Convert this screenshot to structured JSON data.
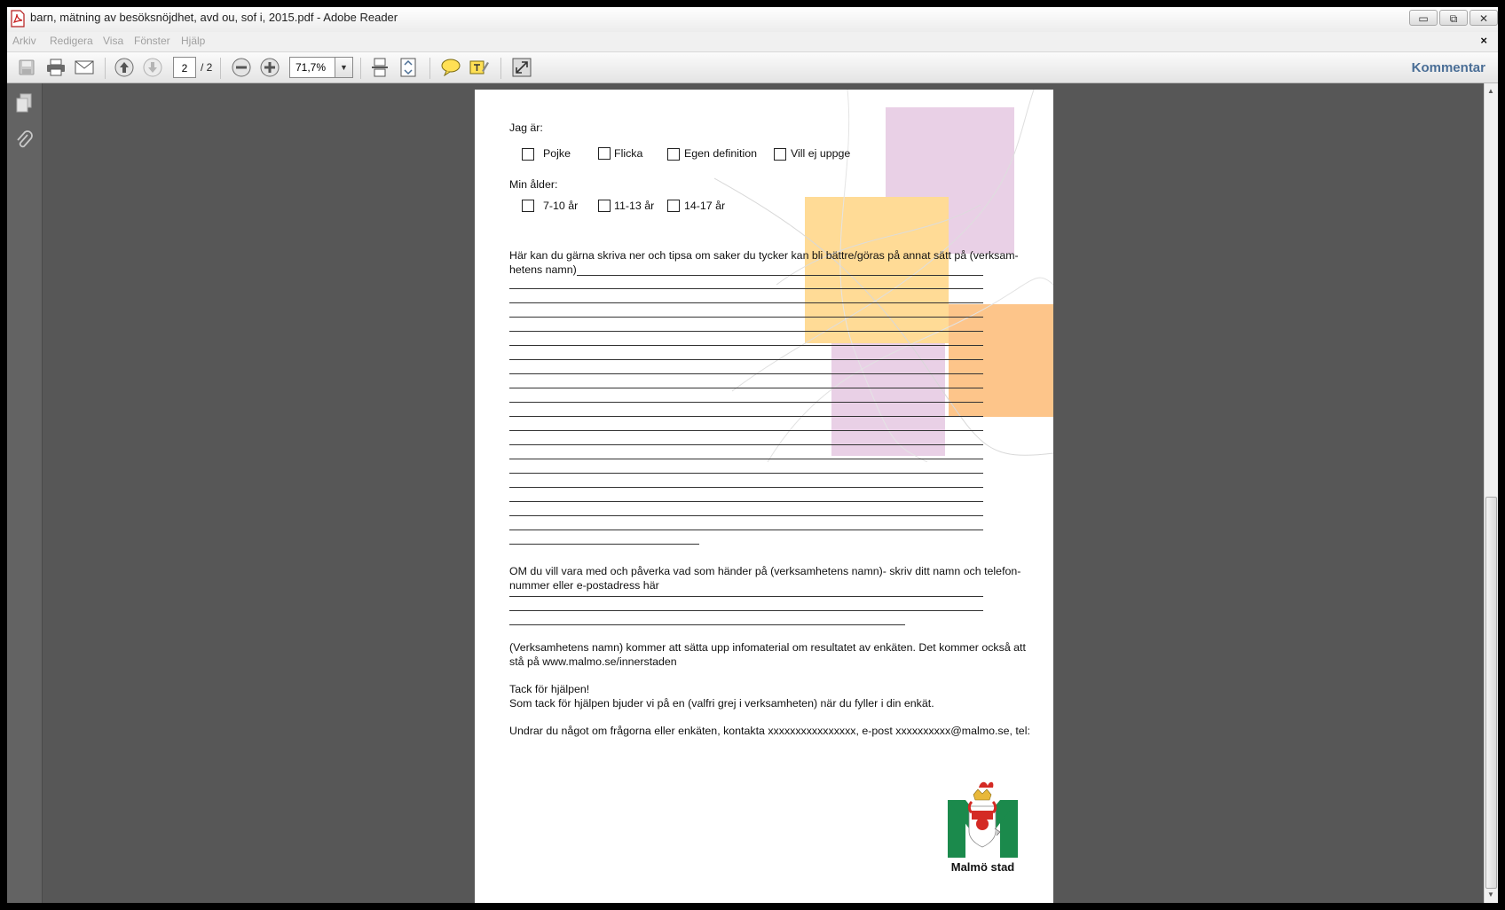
{
  "window": {
    "title": "barn, mätning av besöksnöjdhet, avd ou, sof i, 2015.pdf - Adobe Reader",
    "controls": {
      "minimize": "▭",
      "maximize": "⧉",
      "close": "✕"
    }
  },
  "menu": {
    "items": [
      "Arkiv",
      "Redigera",
      "Visa",
      "Fönster",
      "Hjälp"
    ],
    "close_doc": "×"
  },
  "toolbar": {
    "page_current": "2",
    "page_total": "/ 2",
    "zoom": "71,7%",
    "comment_label": "Kommentar",
    "icons": [
      "save-icon",
      "print-icon",
      "email-icon",
      "prev-page-icon",
      "next-page-icon",
      "zoom-out-icon",
      "zoom-in-icon",
      "scroll-mode-icon",
      "fit-page-icon",
      "sticky-note-icon",
      "highlight-icon",
      "fullscreen-icon"
    ]
  },
  "document": {
    "gender_label": "Jag är:",
    "gender_options": [
      "Pojke",
      "Flicka",
      "Egen definition",
      "Vill ej uppge"
    ],
    "age_label": "Min ålder:",
    "age_options": [
      "7-10 år",
      "11-13 år",
      "14-17 år"
    ],
    "tips_line1": "Här kan du gärna skriva ner och tipsa om saker du tycker kan bli bättre/göras på annat sätt på (verksam-",
    "tips_line2": "hetens namn)",
    "influence_line1": "OM du vill vara med och påverka vad som händer på (verksamhetens namn)- skriv ditt namn och telefon-",
    "influence_line2": "nummer eller e-postadress här",
    "info_line1": "(Verksamhetens namn) kommer att sätta upp infomaterial om resultatet av enkäten. Det kommer också att",
    "info_line2": "stå på www.malmo.se/innerstaden",
    "thanks_heading": "Tack för hjälpen!",
    "thanks_body": "Som tack för hjälpen bjuder vi på en (valfri grej i verksamheten) när du fyller i din enkät.",
    "contact": "Undrar du något om frågorna eller enkäten, kontakta xxxxxxxxxxxxxxxx, e-post xxxxxxxxxx@malmo.se, tel:",
    "logo_text": "Malmö stad"
  },
  "colors": {
    "deco_purple": "#e9d0e6",
    "deco_yellow": "#ffdb96",
    "deco_orange": "#fdc58a",
    "logo_green": "#1b8a4c",
    "logo_red": "#d42a24",
    "accent_blue": "#4a6e96"
  }
}
